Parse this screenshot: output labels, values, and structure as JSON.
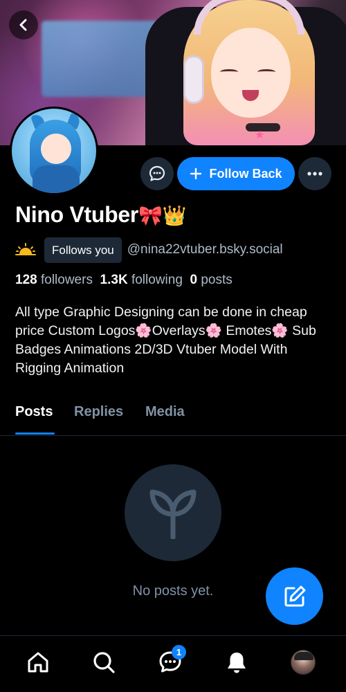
{
  "profile": {
    "display_name": "Nino Vtuber",
    "name_emojis": "🎀👑",
    "follows_you_label": "Follows you",
    "handle": "@nina22vtuber.bsky.social",
    "bio": "All type Graphic Designing can be done in cheap price Custom Logos🌸Overlays🌸 Emotes🌸 Sub Badges Animations 2D/3D Vtuber Model With Rigging Animation"
  },
  "stats": {
    "followers_count": "128",
    "followers_label": "followers",
    "following_count": "1.3K",
    "following_label": "following",
    "posts_count": "0",
    "posts_label": "posts"
  },
  "actions": {
    "follow_back_label": "Follow Back"
  },
  "tabs": [
    {
      "label": "Posts",
      "active": true
    },
    {
      "label": "Replies",
      "active": false
    },
    {
      "label": "Media",
      "active": false
    }
  ],
  "empty_state": {
    "message": "No posts yet.",
    "icon": "sprout-icon"
  },
  "bottom_nav": {
    "items": [
      "home-icon",
      "search-icon",
      "chat-icon",
      "bell-icon",
      "profile-avatar"
    ],
    "chat_badge": "1"
  },
  "colors": {
    "accent": "#1083fe",
    "surface": "#1e2937",
    "muted_text": "#aebbc9",
    "background": "#000000"
  }
}
